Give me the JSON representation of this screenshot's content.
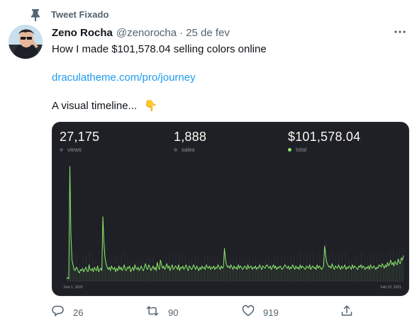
{
  "pinned": {
    "label": "Tweet Fixado",
    "icon": "pin-icon"
  },
  "author": {
    "name": "Zeno Rocha",
    "handle": "@zenorocha",
    "separator": "·",
    "date": "25 de fev"
  },
  "tweet": {
    "line1": "How I made $101,578.04 selling colors online",
    "link": "draculatheme.com/pro/journey",
    "line3": "A visual timeline...",
    "emoji": "👇"
  },
  "media": {
    "stats": [
      {
        "value": "27,175",
        "label": "views",
        "dot_color": "#4b4d57"
      },
      {
        "value": "1,888",
        "label": "sales",
        "dot_color": "#4b4d57"
      },
      {
        "value": "$101,578.04",
        "label": "total",
        "dot_color": "#8be96c"
      }
    ],
    "chart_data": {
      "type": "line",
      "x_start_label": "Feb 1, 2020",
      "x_end_label": "Feb 22, 2021",
      "line_color": "#8be96c",
      "values": [
        2,
        3,
        2,
        98,
        40,
        18,
        14,
        10,
        9,
        12,
        11,
        8,
        7,
        10,
        9,
        11,
        8,
        10,
        12,
        9,
        8,
        14,
        10,
        9,
        11,
        8,
        12,
        10,
        9,
        13,
        8,
        10,
        11,
        9,
        55,
        32,
        20,
        15,
        12,
        10,
        12,
        9,
        13,
        11,
        10,
        12,
        8,
        11,
        9,
        13,
        10,
        12,
        9,
        11,
        14,
        10,
        9,
        12,
        11,
        13,
        8,
        10,
        12,
        9,
        14,
        11,
        10,
        12,
        9,
        11,
        13,
        10,
        9,
        12,
        15,
        11,
        10,
        14,
        12,
        9,
        11,
        13,
        10,
        12,
        9,
        16,
        12,
        10,
        18,
        14,
        11,
        13,
        10,
        12,
        15,
        11,
        13,
        9,
        12,
        14,
        10,
        11,
        13,
        12,
        10,
        14,
        9,
        12,
        11,
        13,
        10,
        12,
        14,
        11,
        9,
        13,
        12,
        10,
        11,
        14,
        12,
        10,
        13,
        11,
        9,
        12,
        10,
        13,
        11,
        12,
        10,
        14,
        12,
        11,
        13,
        10,
        12,
        11,
        13,
        10,
        12,
        11,
        14,
        12,
        10,
        13,
        11,
        12,
        28,
        18,
        14,
        12,
        13,
        11,
        14,
        12,
        10,
        13,
        11,
        12,
        10,
        14,
        11,
        13,
        12,
        10,
        11,
        13,
        12,
        10,
        14,
        11,
        12,
        13,
        10,
        12,
        11,
        13,
        10,
        12,
        11,
        14,
        12,
        10,
        13,
        12,
        11,
        13,
        14,
        12,
        11,
        13,
        10,
        12,
        14,
        11,
        13,
        10,
        12,
        11,
        13,
        12,
        10,
        11,
        13,
        14,
        12,
        11,
        13,
        10,
        12,
        11,
        14,
        12,
        10,
        13,
        11,
        12,
        10,
        14,
        11,
        13,
        12,
        11,
        10,
        13,
        12,
        11,
        14,
        10,
        12,
        13,
        11,
        12,
        10,
        14,
        11,
        13,
        12,
        10,
        11,
        13,
        30,
        22,
        16,
        14,
        12,
        13,
        11,
        15,
        12,
        10,
        13,
        12,
        11,
        14,
        12,
        10,
        13,
        11,
        12,
        14,
        10,
        12,
        11,
        13,
        12,
        10,
        14,
        11,
        13,
        12,
        11,
        10,
        13,
        12,
        14,
        11,
        13,
        12,
        10,
        12,
        11,
        13,
        10,
        14,
        12,
        11,
        13,
        12,
        10,
        12,
        11,
        14,
        13,
        12,
        15,
        13,
        11,
        14,
        12,
        16,
        13,
        15,
        18,
        14,
        16,
        13,
        17,
        15,
        14,
        19,
        16,
        15,
        20,
        18,
        22
      ]
    }
  },
  "actions": [
    {
      "name": "reply-icon",
      "count": "26"
    },
    {
      "name": "retweet-icon",
      "count": "90"
    },
    {
      "name": "like-icon",
      "count": "919"
    },
    {
      "name": "share-icon",
      "count": ""
    }
  ]
}
